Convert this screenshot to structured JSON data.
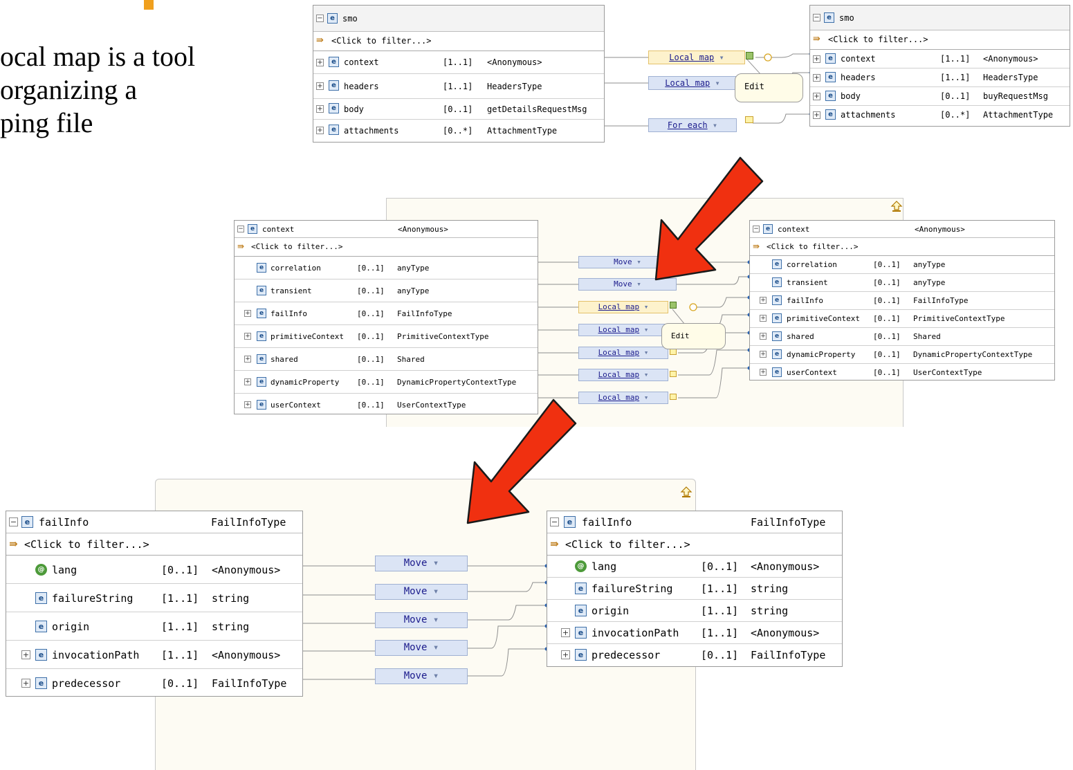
{
  "slide": {
    "text_lines": [
      "ocal map is a tool",
      "organizing a",
      "ping file"
    ]
  },
  "icons": {
    "expand": "plus-box-icon",
    "collapse": "minus-box-icon",
    "element": "element-e-icon",
    "attribute": "attribute-icon",
    "filter": "filter-icon",
    "up": "up-arrow-icon"
  },
  "colors": {
    "transform_box": "#dbe4f5",
    "transform_selected": "#fdf2cc",
    "tooltip": "#fffce8",
    "big_arrow": "#f03010",
    "accent": "#f0a01e"
  },
  "top": {
    "left_panel": {
      "title": "smo",
      "filter": "<Click to filter...>",
      "rows": [
        {
          "name": "context",
          "card": "[1..1]",
          "type": "<Anonymous>"
        },
        {
          "name": "headers",
          "card": "[1..1]",
          "type": "HeadersType"
        },
        {
          "name": "body",
          "card": "[0..1]",
          "type": "getDetailsRequestMsg"
        },
        {
          "name": "attachments",
          "card": "[0..*]",
          "type": "AttachmentType"
        }
      ]
    },
    "transforms": [
      "Local map",
      "Local map",
      "For each"
    ],
    "tooltip": "Edit",
    "right_panel": {
      "title": "smo",
      "filter": "<Click to filter...>",
      "rows": [
        {
          "name": "context",
          "card": "[1..1]",
          "type": "<Anonymous>"
        },
        {
          "name": "headers",
          "card": "[1..1]",
          "type": "HeadersType"
        },
        {
          "name": "body",
          "card": "[0..1]",
          "type": "buyRequestMsg"
        },
        {
          "name": "attachments",
          "card": "[0..*]",
          "type": "AttachmentType"
        }
      ]
    }
  },
  "middle": {
    "left_panel": {
      "title": "context",
      "title_type": "<Anonymous>",
      "filter": "<Click to filter...>",
      "rows": [
        {
          "name": "correlation",
          "card": "[0..1]",
          "type": "anyType"
        },
        {
          "name": "transient",
          "card": "[0..1]",
          "type": "anyType"
        },
        {
          "name": "failInfo",
          "card": "[0..1]",
          "type": "FailInfoType"
        },
        {
          "name": "primitiveContext",
          "card": "[0..1]",
          "type": "PrimitiveContextType"
        },
        {
          "name": "shared",
          "card": "[0..1]",
          "type": "Shared"
        },
        {
          "name": "dynamicProperty",
          "card": "[0..1]",
          "type": "DynamicPropertyContextType"
        },
        {
          "name": "userContext",
          "card": "[0..1]",
          "type": "UserContextType"
        }
      ]
    },
    "transforms": [
      "Move",
      "Move",
      "Local map",
      "Local map",
      "Local map",
      "Local map",
      "Local map"
    ],
    "tooltip": "Edit",
    "right_panel": {
      "title": "context",
      "title_type": "<Anonymous>",
      "filter": "<Click to filter...>",
      "rows": [
        {
          "name": "correlation",
          "card": "[0..1]",
          "type": "anyType"
        },
        {
          "name": "transient",
          "card": "[0..1]",
          "type": "anyType"
        },
        {
          "name": "failInfo",
          "card": "[0..1]",
          "type": "FailInfoType"
        },
        {
          "name": "primitiveContext",
          "card": "[0..1]",
          "type": "PrimitiveContextType"
        },
        {
          "name": "shared",
          "card": "[0..1]",
          "type": "Shared"
        },
        {
          "name": "dynamicProperty",
          "card": "[0..1]",
          "type": "DynamicPropertyContextType"
        },
        {
          "name": "userContext",
          "card": "[0..1]",
          "type": "UserContextType"
        }
      ]
    }
  },
  "bottom": {
    "left_panel": {
      "title": "failInfo",
      "title_type": "FailInfoType",
      "filter": "<Click to filter...>",
      "rows": [
        {
          "name": "lang",
          "card": "[0..1]",
          "type": "<Anonymous>"
        },
        {
          "name": "failureString",
          "card": "[1..1]",
          "type": "string"
        },
        {
          "name": "origin",
          "card": "[1..1]",
          "type": "string"
        },
        {
          "name": "invocationPath",
          "card": "[1..1]",
          "type": "<Anonymous>"
        },
        {
          "name": "predecessor",
          "card": "[0..1]",
          "type": "FailInfoType"
        }
      ]
    },
    "transforms": [
      "Move",
      "Move",
      "Move",
      "Move",
      "Move"
    ],
    "right_panel": {
      "title": "failInfo",
      "title_type": "FailInfoType",
      "filter": "<Click to filter...>",
      "rows": [
        {
          "name": "lang",
          "card": "[0..1]",
          "type": "<Anonymous>"
        },
        {
          "name": "failureString",
          "card": "[1..1]",
          "type": "string"
        },
        {
          "name": "origin",
          "card": "[1..1]",
          "type": "string"
        },
        {
          "name": "invocationPath",
          "card": "[1..1]",
          "type": "<Anonymous>"
        },
        {
          "name": "predecessor",
          "card": "[0..1]",
          "type": "FailInfoType"
        }
      ]
    }
  }
}
